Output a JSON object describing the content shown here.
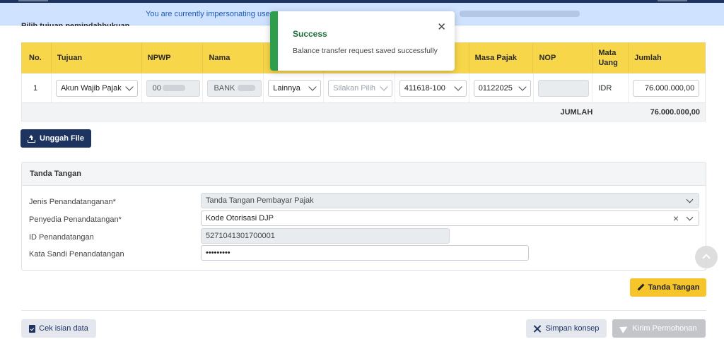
{
  "banner": {
    "text": "You are currently impersonating user:"
  },
  "section_title": "Pilih tujuan pemindahbukuan",
  "table": {
    "headers": [
      "No.",
      "Tujuan",
      "NPWP",
      "Nama",
      "",
      "",
      "",
      "Masa Pajak",
      "NOP",
      "Mata Uang",
      "Jumlah"
    ],
    "row": {
      "no": "1",
      "tujuan": "Akun Wajib Pajak",
      "npwp": "00",
      "nama": "BANK",
      "kolom5": "Lainnya",
      "kolom6_placeholder": "Silakan Pilih",
      "kolom7": "411618-100",
      "masa_pajak": "01122025",
      "nop": "",
      "mata_uang": "IDR",
      "jumlah": "76.000.000,00"
    },
    "footer": {
      "label": "JUMLAH",
      "total": "76.000.000,00"
    }
  },
  "upload_button": {
    "label": "Unggah File",
    "icon": "upload-icon"
  },
  "signature": {
    "title": "Tanda Tangan",
    "fields": {
      "jenis_label": "Jenis Penandatanganan*",
      "jenis_value": "Tanda Tangan Pembayar Pajak",
      "penyedia_label": "Penyedia Penandatangan*",
      "penyedia_value": "Kode Otorisasi DJP",
      "id_label": "ID Penandatangan",
      "id_value": "5271041301700001",
      "sandi_label": "Kata Sandi Penandatangan",
      "sandi_value": "•••••••••"
    }
  },
  "actions": {
    "tanda_tangan": "Tanda Tangan",
    "cek_isian": "Cek isian data",
    "simpan_konsep": "Simpan konsep",
    "kirim_permohonan": "Kirim Permohonan"
  },
  "toast": {
    "title": "Success",
    "message": "Balance transfer request saved successfully",
    "close": "✕"
  },
  "colors": {
    "primary": "#1d3461",
    "table_header": "#f8d649",
    "warning_button": "#f5c52b",
    "success": "#2e9e4d",
    "banner_bg": "#cfe2ff"
  }
}
